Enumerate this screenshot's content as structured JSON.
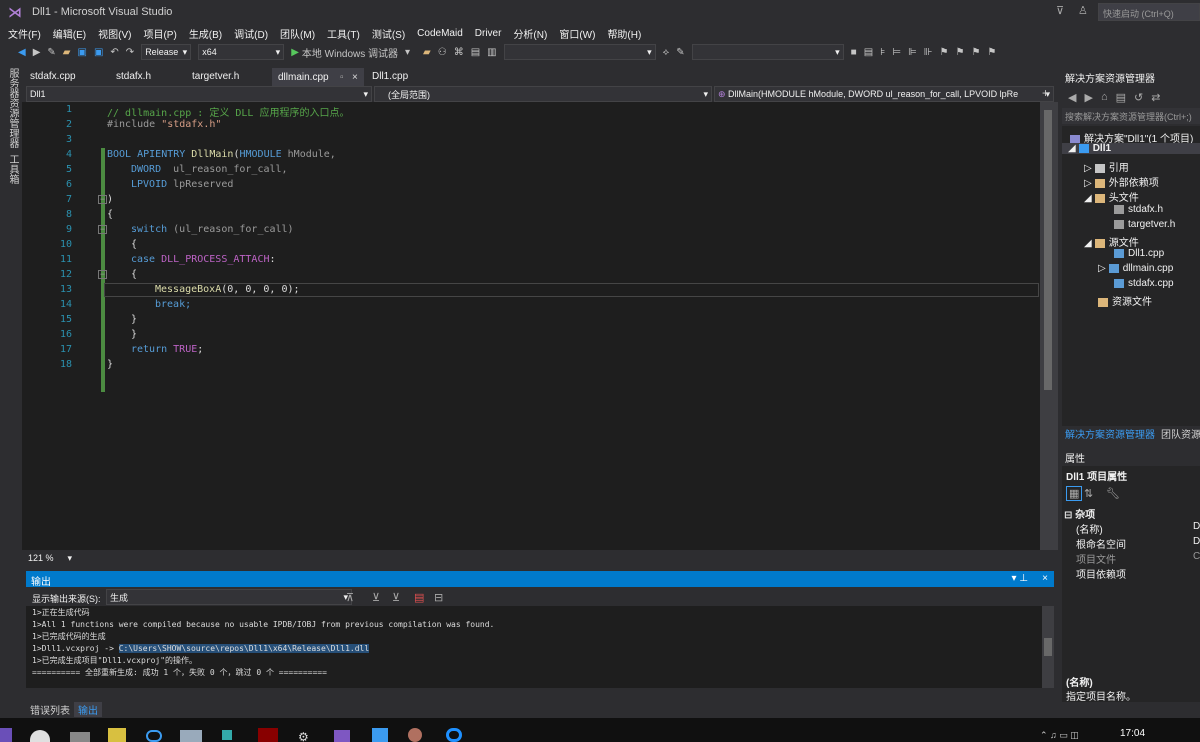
{
  "window": {
    "title": "Dll1 - Microsoft Visual Studio",
    "quick_launch": "快速启动 (Ctrl+Q)"
  },
  "menu": [
    "文件(F)",
    "编辑(E)",
    "视图(V)",
    "项目(P)",
    "生成(B)",
    "调试(D)",
    "团队(M)",
    "工具(T)",
    "测试(S)",
    "CodeMaid",
    "Driver",
    "分析(N)",
    "窗口(W)",
    "帮助(H)"
  ],
  "toolbar": {
    "config": "Release",
    "platform": "x64",
    "run": "本地 Windows 调试器"
  },
  "left_strip": [
    "服务器资源管理器",
    "工具箱"
  ],
  "tabs": [
    "stdafx.cpp",
    "stdafx.h",
    "targetver.h",
    "dllmain.cpp",
    "Dll1.cpp"
  ],
  "navbar": {
    "project": "Dll1",
    "scope": "(全局范围)",
    "member": "DllMain(HMODULE hModule, DWORD ul_reason_for_call, LPVOID lpRe"
  },
  "code": {
    "line_numbers": [
      "1",
      "2",
      "3",
      "4",
      "5",
      "6",
      "7",
      "8",
      "9",
      "10",
      "11",
      "12",
      "13",
      "14",
      "15",
      "16",
      "17",
      "18"
    ],
    "l1": "// dllmain.cpp : 定义 DLL 应用程序的入口点。",
    "l2a": "#include ",
    "l2b": "\"stdafx.h\"",
    "l4a": "BOOL ",
    "l4b": "APIENTRY ",
    "l4c": "DllMain",
    "l4d": "(",
    "l4e": "HMODULE ",
    "l4f": "hModule,",
    "l5a": "DWORD  ",
    "l5b": "ul_reason_for_call,",
    "l6a": "LPVOID ",
    "l6b": "lpReserved",
    "l7": ")",
    "l8": "{",
    "l9a": "switch ",
    "l9b": "(ul_reason_for_call)",
    "l10": "{",
    "l11a": "case ",
    "l11b": "DLL_PROCESS_ATTACH",
    ":": ":",
    "l12": "{",
    "l13a": "MessageBoxA",
    "l13b": "(0, 0, 0, 0);",
    "l14": "break;",
    "l15": "}",
    "l16": "}",
    "l17a": "return ",
    "l17b": "TRUE",
    ";": ";",
    "l18": "}"
  },
  "zoom": "121 %",
  "output": {
    "title": "输出",
    "source_label": "显示输出来源(S):",
    "source": "生成",
    "lines": [
      "1>正在生成代码",
      "1>All 1 functions were compiled because no usable IPDB/IOBJ from previous compilation was found.",
      "1>已完成代码的生成",
      "1>Dll1.vcxproj -> ",
      "1>已完成生成项目\"Dll1.vcxproj\"的操作。",
      "========== 全部重新生成: 成功 1 个，失败 0 个，跳过 0 个 =========="
    ],
    "path": "C:\\Users\\SHOW\\source\\repos\\Dll1\\x64\\Release\\Dll1.dll"
  },
  "bottom_tabs": [
    "错误列表",
    "输出"
  ],
  "solution_explorer": {
    "title": "解决方案资源管理器",
    "search": "搜索解决方案资源管理器(Ctrl+;)",
    "items": [
      {
        "label": "解决方案\"Dll1\"(1 个项目)"
      },
      {
        "label": "Dll1"
      },
      {
        "label": "引用"
      },
      {
        "label": "外部依赖项"
      },
      {
        "label": "头文件"
      },
      {
        "label": "stdafx.h"
      },
      {
        "label": "targetver.h"
      },
      {
        "label": "源文件"
      },
      {
        "label": "Dll1.cpp"
      },
      {
        "label": "dllmain.cpp"
      },
      {
        "label": "stdafx.cpp"
      },
      {
        "label": "资源文件"
      }
    ],
    "tabs": [
      "解决方案资源管理器",
      "团队资源管"
    ]
  },
  "properties": {
    "title": "属性",
    "object": "Dll1 项目属性",
    "category": "杂项",
    "rows": [
      {
        "name": "(名称)",
        "value": "D"
      },
      {
        "name": "根命名空间",
        "value": "D"
      },
      {
        "name": "项目文件",
        "value": "C"
      },
      {
        "name": "项目依赖项",
        "value": ""
      }
    ],
    "desc_title": "(名称)",
    "desc": "指定项目名称。"
  },
  "taskbar": {
    "time": "17:04"
  }
}
